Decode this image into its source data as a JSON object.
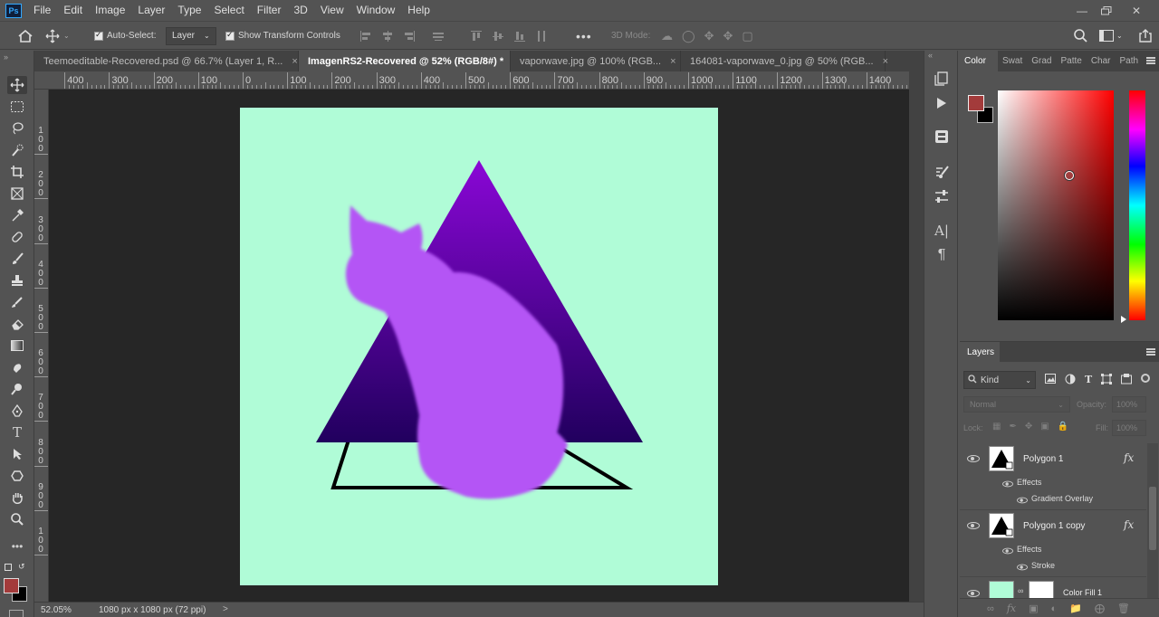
{
  "app": {
    "logo": "Ps"
  },
  "menu": [
    "File",
    "Edit",
    "Image",
    "Layer",
    "Type",
    "Select",
    "Filter",
    "3D",
    "View",
    "Window",
    "Help"
  ],
  "options_bar": {
    "auto_select_label": "Auto-Select:",
    "auto_select_value": "Layer",
    "show_transform_label": "Show Transform Controls",
    "three_d_mode_label": "3D Mode:"
  },
  "tabs": [
    {
      "label": "Teemoeditable-Recovered.psd @ 66.7% (Layer 1, R...",
      "close": "×"
    },
    {
      "label": "ImagenRS2-Recovered @ 52% (RGB/8#) *",
      "close": "×"
    },
    {
      "label": "vaporwave.jpg @ 100% (RGB...",
      "close": "×"
    },
    {
      "label": "164081-vaporwave_0.jpg @ 50% (RGB...",
      "close": "×"
    }
  ],
  "ruler_h": [
    "400",
    "300",
    "200",
    "100",
    "0",
    "100",
    "200",
    "300",
    "400",
    "500",
    "600",
    "700",
    "800",
    "900",
    "1000",
    "1100",
    "1200",
    "1300",
    "1400"
  ],
  "ruler_v": [
    "1\n0\n0",
    "2\n0\n0",
    "3\n0\n0",
    "4\n0\n0",
    "5\n0\n0",
    "6\n0\n0",
    "7\n0\n0",
    "8\n0\n0",
    "9\n0\n0",
    "1\n0\n0"
  ],
  "status": {
    "zoom": "52.05%",
    "doc_size": "1080 px x 1080 px (72 ppi)",
    "arrow": ">"
  },
  "color_panel": {
    "tabs": [
      "Color",
      "Swat",
      "Grad",
      "Patte",
      "Char",
      "Path"
    ],
    "foreground": "#a33b3b",
    "background": "#000000",
    "hue_base": "#ff0000"
  },
  "layers_panel": {
    "title": "Layers",
    "filter_kind": "Kind",
    "blend_mode": "Normal",
    "opacity_label": "Opacity:",
    "opacity_value": "100%",
    "lock_label": "Lock:",
    "fill_label": "Fill:",
    "fill_value": "100%",
    "layers": [
      {
        "name": "Polygon 1",
        "fx": "fx",
        "effects_label": "Effects",
        "effect": "Gradient Overlay"
      },
      {
        "name": "Polygon 1 copy",
        "fx": "fx",
        "effects_label": "Effects",
        "effect": "Stroke"
      },
      {
        "name": "Color Fill 1"
      }
    ]
  },
  "document": {
    "bg_color": "#b0fcd7",
    "triangle_top": "#8a07d6",
    "triangle_bottom": "#21005e",
    "cat_color": "#b455f5",
    "outline_color": "#000000"
  }
}
